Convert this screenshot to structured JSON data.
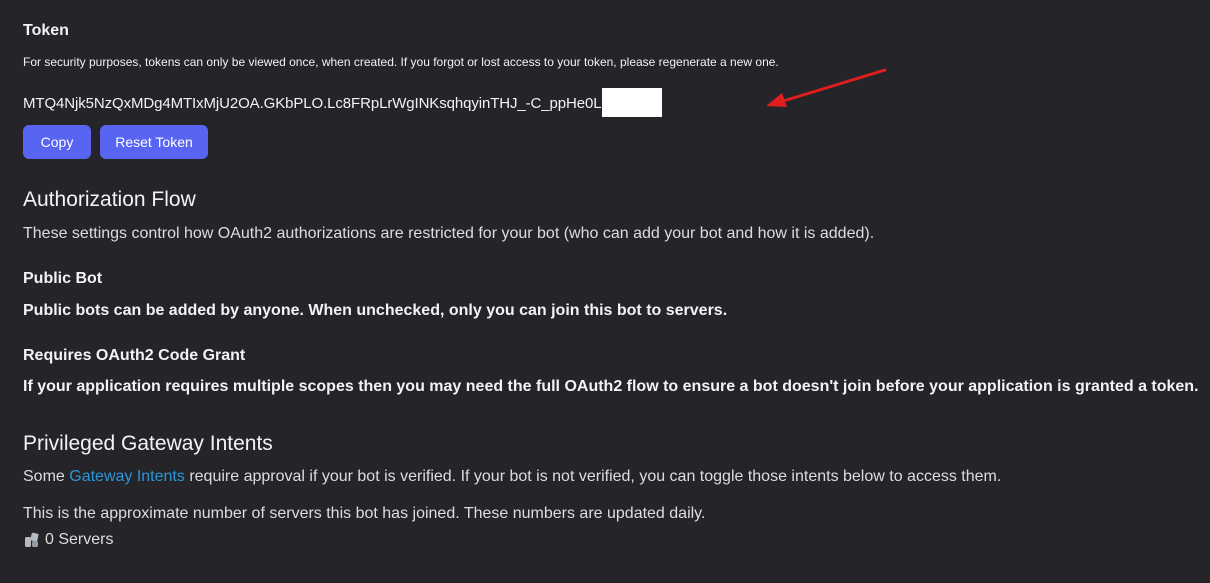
{
  "token": {
    "title": "Token",
    "description": "For security purposes, tokens can only be viewed once, when created. If you forgot or lost access to your token, please regenerate a new one.",
    "value": "MTQ4Njk5NzQxMDg4MTIxMjU2OA.GKbPLO.Lc8FRpLrWgINKsqhqyinTHJ_-C_ppHe0L",
    "copy_label": "Copy",
    "reset_label": "Reset Token"
  },
  "authorization": {
    "title": "Authorization Flow",
    "description": "These settings control how OAuth2 authorizations are restricted for your bot (who can add your bot and how it is added)."
  },
  "public_bot": {
    "title": "Public Bot",
    "description": "Public bots can be added by anyone. When unchecked, only you can join this bot to servers."
  },
  "code_grant": {
    "title": "Requires OAuth2 Code Grant",
    "description": "If your application requires multiple scopes then you may need the full OAuth2 flow to ensure a bot doesn't join before your application is granted a token."
  },
  "intents": {
    "title": "Privileged Gateway Intents",
    "desc_prefix": "Some ",
    "link_text": "Gateway Intents",
    "desc_suffix": " require approval if your bot is verified. If your bot is not verified, you can toggle those intents below to access them."
  },
  "servers": {
    "description": "This is the approximate number of servers this bot has joined. These numbers are updated daily.",
    "count_label": "0 Servers",
    "icon": "servers-icon"
  },
  "colors": {
    "background": "#242429",
    "button": "#5865f2",
    "link": "#2a96d8",
    "arrow": "#e01e1e"
  }
}
